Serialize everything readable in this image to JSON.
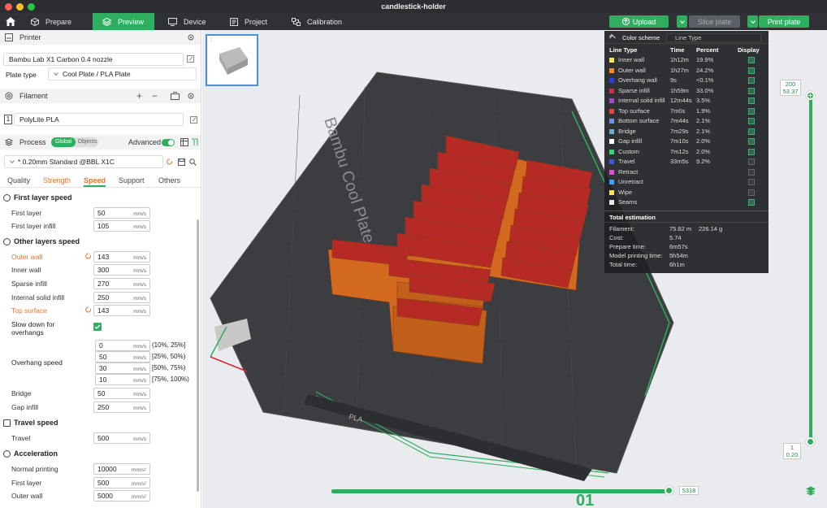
{
  "window": {
    "title": "candlestick-holder"
  },
  "nav": {
    "tabs": [
      {
        "label": "Prepare"
      },
      {
        "label": "Preview"
      },
      {
        "label": "Device"
      },
      {
        "label": "Project"
      },
      {
        "label": "Calibration"
      }
    ],
    "upload": "Upload",
    "slice": "Slice plate",
    "print": "Print plate"
  },
  "printer": {
    "header": "Printer",
    "name": "Bambu Lab X1 Carbon 0.4 nozzle",
    "plate_label": "Plate type",
    "plate_value": "Cool Plate / PLA Plate"
  },
  "filament": {
    "header": "Filament",
    "slot": "1",
    "name": "PolyLite PLA"
  },
  "process": {
    "header": "Process",
    "toggle_global": "Global",
    "toggle_objects": "Objects",
    "advanced": "Advanced",
    "preset": "* 0.20mm Standard @BBL X1C",
    "tabs": [
      "Quality",
      "Strength",
      "Speed",
      "Support",
      "Others"
    ]
  },
  "speed": {
    "first_layer_title": "First layer speed",
    "first_layer": {
      "label": "First layer",
      "value": "50",
      "unit": "mm/s"
    },
    "first_layer_infill": {
      "label": "First layer infill",
      "value": "105",
      "unit": "mm/s"
    },
    "other_title": "Other layers speed",
    "outer_wall": {
      "label": "Outer wall",
      "value": "143",
      "unit": "mm/s"
    },
    "inner_wall": {
      "label": "Inner wall",
      "value": "300",
      "unit": "mm/s"
    },
    "sparse_infill": {
      "label": "Sparse infill",
      "value": "270",
      "unit": "mm/s"
    },
    "internal_solid": {
      "label": "Internal solid infill",
      "value": "250",
      "unit": "mm/s"
    },
    "top_surface": {
      "label": "Top surface",
      "value": "143",
      "unit": "mm/s"
    },
    "slow_down_line1": "Slow down for",
    "slow_down_line2": "overhangs",
    "overhang_label": "Overhang speed",
    "overhang": [
      {
        "value": "0",
        "unit": "mm/s",
        "range": "(10%, 25%]"
      },
      {
        "value": "50",
        "unit": "mm/s",
        "range": "[25%, 50%)"
      },
      {
        "value": "30",
        "unit": "mm/s",
        "range": "[50%, 75%)"
      },
      {
        "value": "10",
        "unit": "mm/s",
        "range": "[75%, 100%)"
      }
    ],
    "bridge": {
      "label": "Bridge",
      "value": "50",
      "unit": "mm/s"
    },
    "gap_infill": {
      "label": "Gap infill",
      "value": "250",
      "unit": "mm/s"
    },
    "travel_title": "Travel speed",
    "travel": {
      "label": "Travel",
      "value": "500",
      "unit": "mm/s"
    },
    "accel_title": "Acceleration",
    "normal_printing": {
      "label": "Normal printing",
      "value": "10000",
      "unit": "mm/s²"
    },
    "accel_first_layer": {
      "label": "First layer",
      "value": "500",
      "unit": "mm/s²"
    },
    "accel_outer_wall": {
      "label": "Outer wall",
      "value": "5000",
      "unit": "mm/s²"
    }
  },
  "legend": {
    "scheme_label": "Color scheme",
    "scheme_value": "Line Type",
    "headers": [
      "Line Type",
      "Time",
      "Percent",
      "Display"
    ],
    "rows": [
      {
        "name": "Inner wall",
        "time": "1h12m",
        "pct": "19.9%",
        "color": "#f5e25a",
        "on": true
      },
      {
        "name": "Outer wall",
        "time": "1h27m",
        "pct": "24.2%",
        "color": "#f08a2a",
        "on": true
      },
      {
        "name": "Overhang wall",
        "time": "9s",
        "pct": "<0.1%",
        "color": "#2a3fd6",
        "on": true
      },
      {
        "name": "Sparse infill",
        "time": "1h59m",
        "pct": "33.0%",
        "color": "#c2334a",
        "on": true
      },
      {
        "name": "Internal solid infill",
        "time": "12m44s",
        "pct": "3.5%",
        "color": "#a24bc4",
        "on": true
      },
      {
        "name": "Top surface",
        "time": "7m0s",
        "pct": "1.9%",
        "color": "#e0483c",
        "on": true
      },
      {
        "name": "Bottom surface",
        "time": "7m44s",
        "pct": "2.1%",
        "color": "#6f8fe0",
        "on": true
      },
      {
        "name": "Bridge",
        "time": "7m29s",
        "pct": "2.1%",
        "color": "#6bb0c8",
        "on": true
      },
      {
        "name": "Gap infill",
        "time": "7m10s",
        "pct": "2.0%",
        "color": "#ffffff",
        "on": true
      },
      {
        "name": "Custom",
        "time": "7m12s",
        "pct": "2.0%",
        "color": "#3fcf7a",
        "on": true
      },
      {
        "name": "Travel",
        "time": "33m5s",
        "pct": "9.2%",
        "color": "#3a5bd8",
        "on": false
      },
      {
        "name": "Retract",
        "time": "",
        "pct": "",
        "color": "#e04fd0",
        "on": false
      },
      {
        "name": "Unretract",
        "time": "",
        "pct": "",
        "color": "#3fa0ff",
        "on": false
      },
      {
        "name": "Wipe",
        "time": "",
        "pct": "",
        "color": "#f5e25a",
        "on": false
      },
      {
        "name": "Seams",
        "time": "",
        "pct": "",
        "color": "#e8e8e8",
        "on": true
      }
    ],
    "total_title": "Total estimation",
    "filament_label": "Filament:",
    "filament_m": "75.82 m",
    "filament_g": "226.14 g",
    "cost_label": "Cost:",
    "cost": "5.74",
    "prepare_label": "Prepare time:",
    "prepare": "6m57s",
    "model_label": "Model printing time:",
    "model": "5h54m",
    "total_label": "Total time:",
    "total": "6h1m"
  },
  "viewport": {
    "plate_text": "Bambu Cool Plate",
    "plate_brand": "PLA",
    "plate_number": "01",
    "thumb_index": "1",
    "layer_top": "200",
    "layer_top_height": "53.37",
    "layer_bottom": "1",
    "layer_bottom_height": "0.20",
    "move_value": "5318"
  }
}
